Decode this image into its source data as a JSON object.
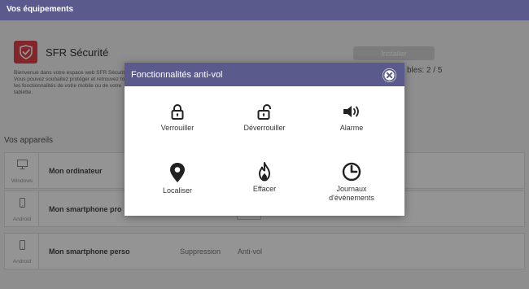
{
  "header": {
    "title": "Vos équipements"
  },
  "app": {
    "name": "SFR Sécurité",
    "intro": "Bienvenue dans votre espace web SFR Sécurité. Vous pouvez souhaitez protéger et retrouvez toutes les fonctionnalités de votre mobile ou de votre tablette.",
    "install_label": "Installer",
    "slots_text": "bles: 2 / 5"
  },
  "devices": {
    "title": "Vos appareils",
    "items": [
      {
        "os": "Windows",
        "name": "Mon ordinateur",
        "icon": "monitor-icon"
      },
      {
        "os": "Android",
        "name": "Mon smartphone pro",
        "icon": "smartphone-icon"
      },
      {
        "os": "Android",
        "name": "Mon smartphone perso",
        "icon": "smartphone-icon",
        "action_delete": "Suppression",
        "action_antitheft": "Anti-vol"
      }
    ]
  },
  "modal": {
    "title": "Fonctionnalités anti-vol",
    "features": [
      {
        "label": "Verrouiller",
        "icon": "lock-icon"
      },
      {
        "label": "Déverrouiller",
        "icon": "unlock-icon"
      },
      {
        "label": "Alarme",
        "icon": "speaker-icon"
      },
      {
        "label": "Localiser",
        "icon": "map-pin-icon"
      },
      {
        "label": "Effacer",
        "icon": "flame-icon"
      },
      {
        "label": "Journaux d'événements",
        "icon": "clock-icon"
      }
    ]
  },
  "colors": {
    "header": "#5b5a8d",
    "brand": "#e2434b"
  }
}
